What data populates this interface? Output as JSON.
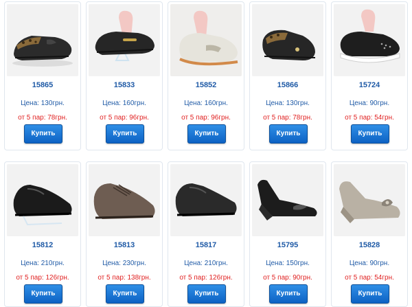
{
  "colors": {
    "code": "#1f5aa6",
    "price": "#1f5aa6",
    "bulk": "#e02020",
    "button": "#1577d6"
  },
  "rows": [
    {
      "products": [
        {
          "code": "15865",
          "price": "Цена: 130грн.",
          "bulk": "от 5 пар: 78грн.",
          "buy": "Купить",
          "icon": "shoe-flat-leopard-icon"
        },
        {
          "code": "15833",
          "price": "Цена: 160грн.",
          "bulk": "от 5 пар: 96грн.",
          "buy": "Купить",
          "icon": "shoe-loafer-black-icon"
        },
        {
          "code": "15852",
          "price": "Цена: 160грн.",
          "bulk": "от 5 пар: 96грн.",
          "buy": "Купить",
          "icon": "shoe-loafer-beige-icon"
        },
        {
          "code": "15866",
          "price": "Цена: 130грн.",
          "bulk": "от 5 пар: 78грн.",
          "buy": "Купить",
          "icon": "shoe-flat-leopard-icon"
        },
        {
          "code": "15724",
          "price": "Цена: 90грн.",
          "bulk": "от 5 пар: 54грн.",
          "buy": "Купить",
          "icon": "shoe-sneaker-icon"
        }
      ]
    },
    {
      "products": [
        {
          "code": "15812",
          "price": "Цена: 210грн.",
          "bulk": "от 5 пар: 126грн.",
          "buy": "Купить",
          "icon": "shoe-mens-black-icon"
        },
        {
          "code": "15813",
          "price": "Цена: 230грн.",
          "bulk": "от 5 пар: 138грн.",
          "buy": "Купить",
          "icon": "shoe-mens-brown-icon"
        },
        {
          "code": "15817",
          "price": "Цена: 210грн.",
          "bulk": "от 5 пар: 126грн.",
          "buy": "Купить",
          "icon": "shoe-mens-black-icon"
        },
        {
          "code": "15795",
          "price": "Цена: 150грн.",
          "bulk": "от 5 пар: 90грн.",
          "buy": "Купить",
          "icon": "shoe-wedge-black-icon"
        },
        {
          "code": "15828",
          "price": "Цена: 90грн.",
          "bulk": "от 5 пар: 54грн.",
          "buy": "Купить",
          "icon": "shoe-flat-grey-bow-icon"
        }
      ]
    }
  ]
}
